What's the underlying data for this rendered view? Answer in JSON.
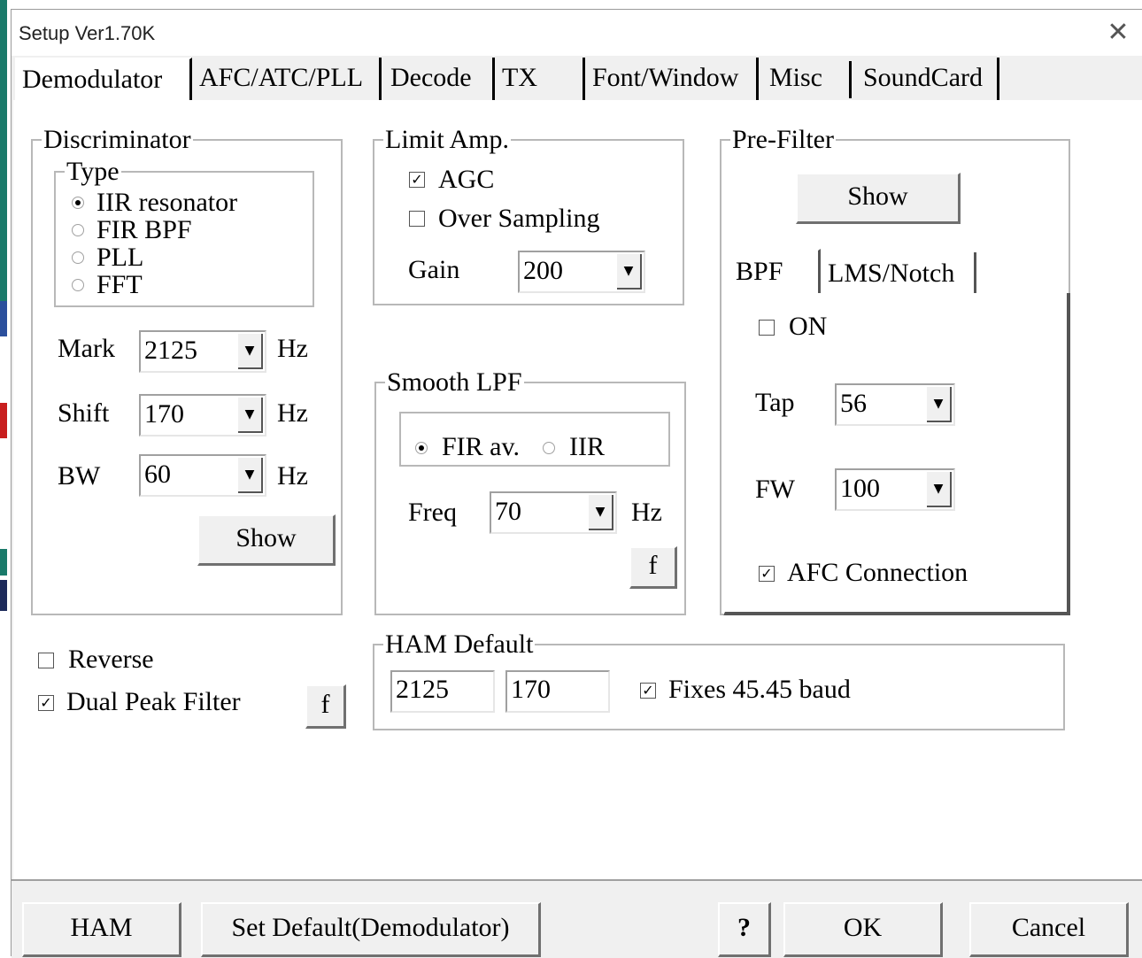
{
  "window": {
    "title": "Setup Ver1.70K",
    "close_glyph": "✕"
  },
  "tabs": [
    "Demodulator",
    "AFC/ATC/PLL",
    "Decode",
    "TX",
    "Font/Window",
    "Misc",
    "SoundCard"
  ],
  "discriminator": {
    "title": "Discriminator",
    "type_title": "Type",
    "types": [
      "IIR resonator",
      "FIR BPF",
      "PLL",
      "FFT"
    ],
    "selected_type": "IIR resonator",
    "mark_label": "Mark",
    "mark_value": "2125",
    "shift_label": "Shift",
    "shift_value": "170",
    "bw_label": "BW",
    "bw_value": "60",
    "unit": "Hz",
    "show_label": "Show"
  },
  "limit_amp": {
    "title": "Limit Amp.",
    "agc_label": "AGC",
    "agc_checked": true,
    "oversampling_label": "Over Sampling",
    "oversampling_checked": false,
    "gain_label": "Gain",
    "gain_value": "200"
  },
  "smooth_lpf": {
    "title": "Smooth LPF",
    "fir_label": "FIR av.",
    "iir_label": "IIR",
    "selected": "FIR av.",
    "freq_label": "Freq",
    "freq_value": "70",
    "unit": "Hz",
    "f_label": "f"
  },
  "pre_filter": {
    "title": "Pre-Filter",
    "show_label": "Show",
    "subtabs": [
      "BPF",
      "LMS/Notch"
    ],
    "on_label": "ON",
    "on_checked": false,
    "tap_label": "Tap",
    "tap_value": "56",
    "fw_label": "FW",
    "fw_value": "100",
    "afc_label": "AFC Connection",
    "afc_checked": true
  },
  "options": {
    "reverse_label": "Reverse",
    "reverse_checked": false,
    "dual_peak_label": "Dual Peak Filter",
    "dual_peak_checked": true,
    "f_label": "f"
  },
  "ham_default": {
    "title": "HAM Default",
    "mark_value": "2125",
    "shift_value": "170",
    "fixes_label": "Fixes 45.45 baud",
    "fixes_checked": true
  },
  "footer": {
    "ham_label": "HAM",
    "set_default_label": "Set Default(Demodulator)",
    "help_label": "?",
    "ok_label": "OK",
    "cancel_label": "Cancel"
  },
  "icons": {
    "checked": "✓",
    "dropdown": "▼"
  },
  "colors": {
    "window_bg": "#f0f0f0",
    "panel_bg": "#ffffff",
    "group_border": "#b8b8b8"
  }
}
